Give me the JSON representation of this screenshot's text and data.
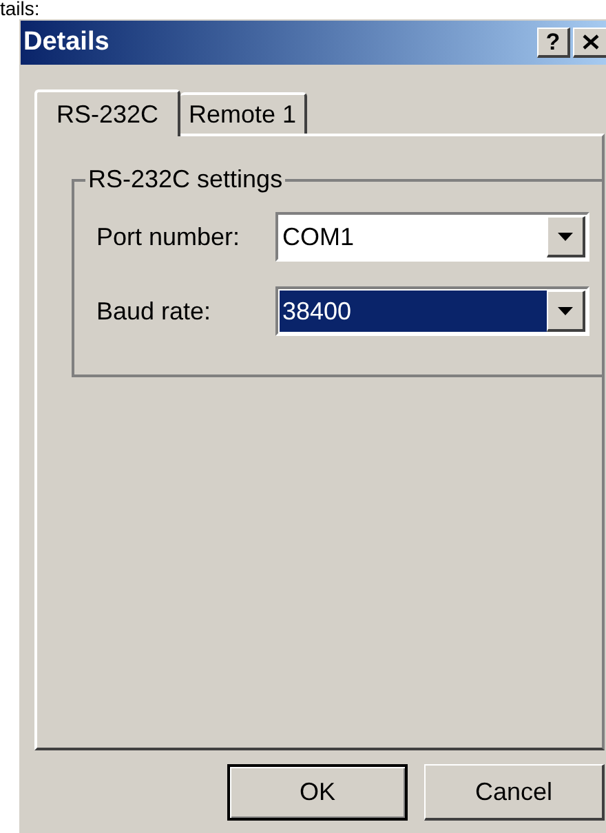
{
  "caption_fragment": "tails:",
  "window": {
    "title": "Details",
    "help_button": "?"
  },
  "tabs": [
    {
      "label": "RS-232C",
      "selected": true
    },
    {
      "label": "Remote 1",
      "selected": false
    }
  ],
  "group": {
    "title": "RS-232C settings",
    "fields": [
      {
        "label": "Port number:",
        "value": "COM1",
        "selected": false
      },
      {
        "label": "Baud rate:",
        "value": "38400",
        "selected": true
      }
    ]
  },
  "buttons": [
    {
      "label": "OK",
      "default": true
    },
    {
      "label": "Cancel",
      "default": false
    }
  ]
}
